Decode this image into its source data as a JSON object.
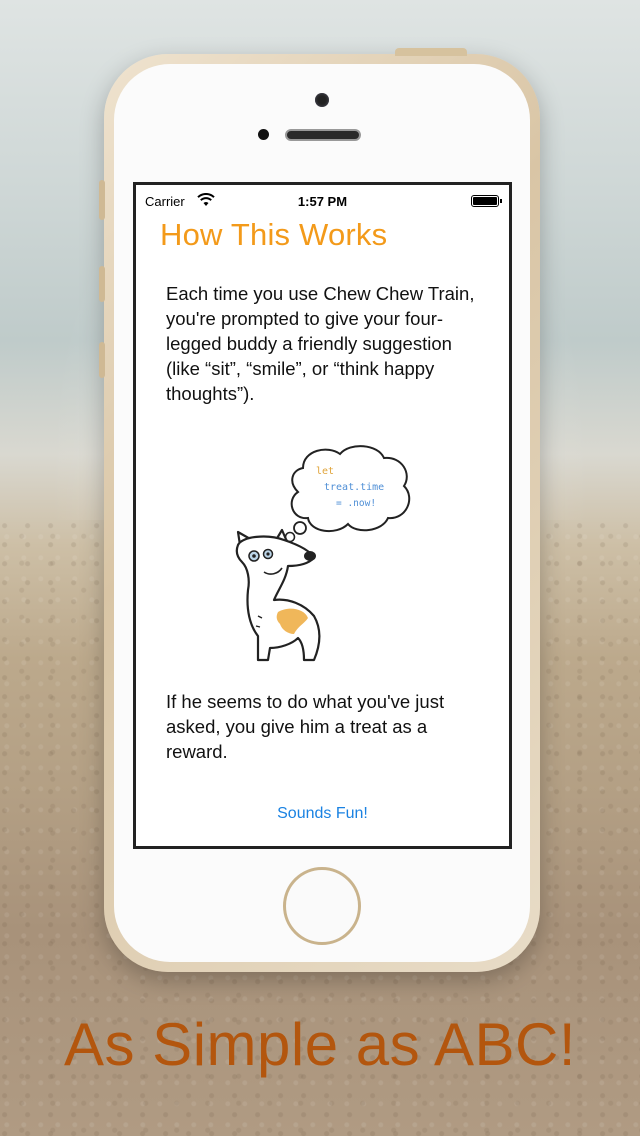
{
  "status_bar": {
    "carrier": "Carrier",
    "time": "1:57 PM"
  },
  "screen": {
    "title": "How This Works",
    "paragraph1": "Each time you use Chew Chew Train, you're prompted  to give your four-legged buddy a friendly suggestion (like “sit”, “smile”, or “think happy thoughts”).",
    "code_bubble": [
      "let",
      "treat.time",
      "= .now!"
    ],
    "paragraph2": "If he seems to do what you've just asked, you give him a treat as a reward.",
    "button_label": "Sounds Fun!"
  },
  "tagline": "As Simple as ABC!",
  "colors": {
    "title_orange": "#f39a1a",
    "link_blue": "#1a82e2",
    "tagline_orange": "#b3560e"
  }
}
